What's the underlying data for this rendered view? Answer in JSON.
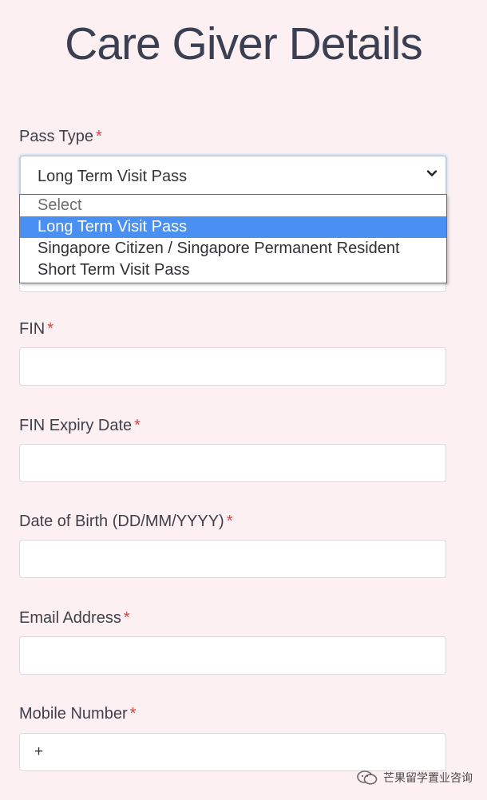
{
  "page": {
    "title": "Care Giver Details",
    "required_marker": "*"
  },
  "pass_type": {
    "label": "Pass Type",
    "selected_value": "Long Term Visit Pass",
    "options": [
      "Select",
      "Long Term Visit Pass",
      "Singapore Citizen / Singapore Permanent Resident",
      "Short Term Visit Pass"
    ]
  },
  "fin": {
    "label": "FIN",
    "value": ""
  },
  "fin_expiry": {
    "label": "FIN Expiry Date",
    "value": ""
  },
  "dob": {
    "label": "Date of Birth (DD/MM/YYYY)",
    "value": ""
  },
  "email": {
    "label": "Email Address",
    "value": ""
  },
  "mobile": {
    "label": "Mobile Number",
    "value": "+"
  },
  "watermark": {
    "text": "芒果留学置业咨询",
    "icon": "wechat-icon"
  },
  "colors": {
    "background": "#fcf0f2",
    "required": "#d64545",
    "option_highlight": "#4a8ff2"
  }
}
